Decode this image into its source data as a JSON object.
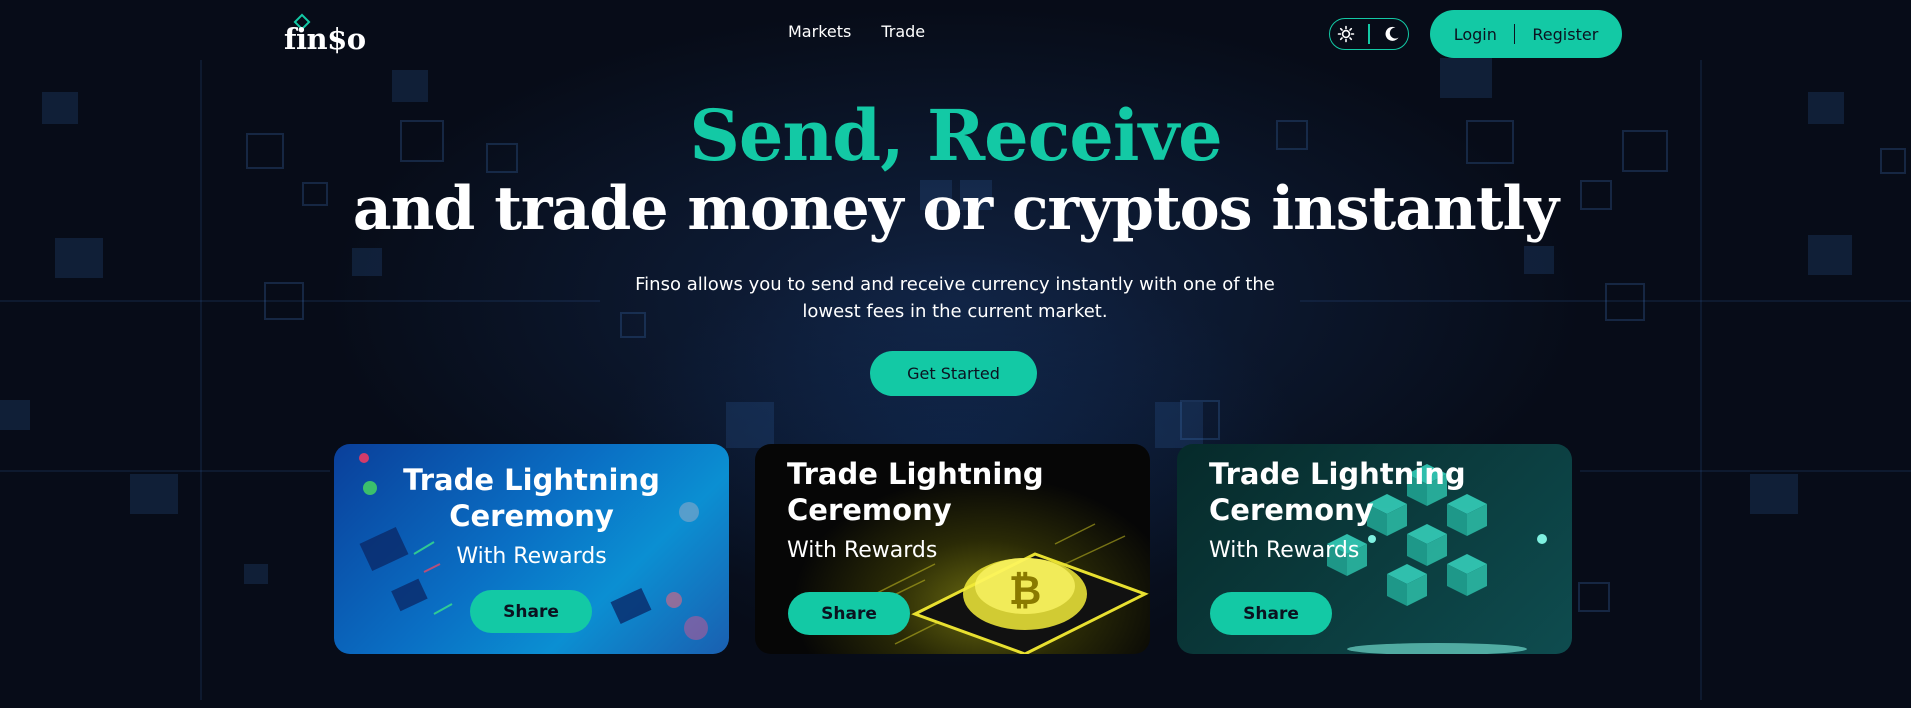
{
  "brand": {
    "name": "fin$o",
    "accent": "#13c9a5",
    "background": "#070c18"
  },
  "nav": {
    "items": [
      {
        "label": "Markets"
      },
      {
        "label": "Trade"
      }
    ]
  },
  "theme_toggle": {
    "light_icon": "sun-icon",
    "dark_icon": "moon-icon"
  },
  "auth": {
    "login": "Login",
    "register": "Register"
  },
  "hero": {
    "title_line1": "Send, Receive",
    "title_line2": "and trade money or cryptos instantly",
    "subtitle": "Finso allows you to send and receive currency instantly with one of the lowest fees in the current market.",
    "cta": "Get Started"
  },
  "cards": [
    {
      "title_line1": "Trade Lightning",
      "title_line2": "Ceremony",
      "subtitle": "With Rewards",
      "button": "Share",
      "art": "circuit-board-art"
    },
    {
      "title_line1": "Trade Lightning",
      "title_line2": "Ceremony",
      "subtitle": "With Rewards",
      "button": "Share",
      "art": "bitcoin-chip-art"
    },
    {
      "title_line1": "Trade Lightning",
      "title_line2": "Ceremony",
      "subtitle": "With Rewards",
      "button": "Share",
      "art": "blockchain-cubes-art"
    }
  ]
}
